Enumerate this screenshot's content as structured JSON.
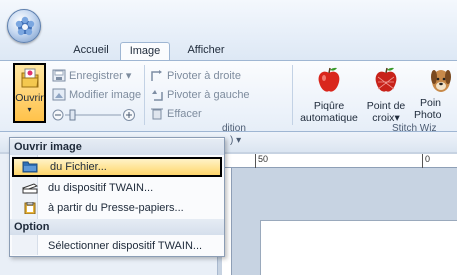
{
  "ribbon_tabs": [
    "Accueil",
    "Image",
    "Afficher"
  ],
  "active_tab": "Image",
  "image_group": {
    "open_button_label": "Ouvrir",
    "save_label": "Enregistrer",
    "modify_label": "Modifier image",
    "rotate_right_label": "Pivoter à droite",
    "rotate_left_label": "Pivoter à gauche",
    "erase_label": "Effacer",
    "group_label_partial": "dition"
  },
  "stitch_group": {
    "buttons": [
      {
        "line1": "Piqûre",
        "line2": "automatique"
      },
      {
        "line1": "Point de",
        "line2": "croix"
      },
      {
        "line1": "Poin",
        "line2": "Photo"
      }
    ],
    "group_label_partial": "Stitch Wiz"
  },
  "open_menu": {
    "header": "Ouvrir image",
    "items": [
      {
        "label": "du Fichier...",
        "icon": "folder-icon",
        "selected": true
      },
      {
        "label": "du dispositif TWAIN...",
        "icon": "scanner-icon",
        "selected": false
      },
      {
        "label": "à partir du Presse-papiers...",
        "icon": "clipboard-icon",
        "selected": false
      }
    ],
    "option_header": "Option",
    "option_items": [
      {
        "label": "Sélectionner dispositif TWAIN..."
      }
    ]
  },
  "ruler": {
    "labels": [
      "50",
      "0"
    ]
  },
  "colors": {
    "accent_hover": "#ffd66b",
    "ribbon_bg": "#e6eef8",
    "border": "#9fb6d3"
  }
}
